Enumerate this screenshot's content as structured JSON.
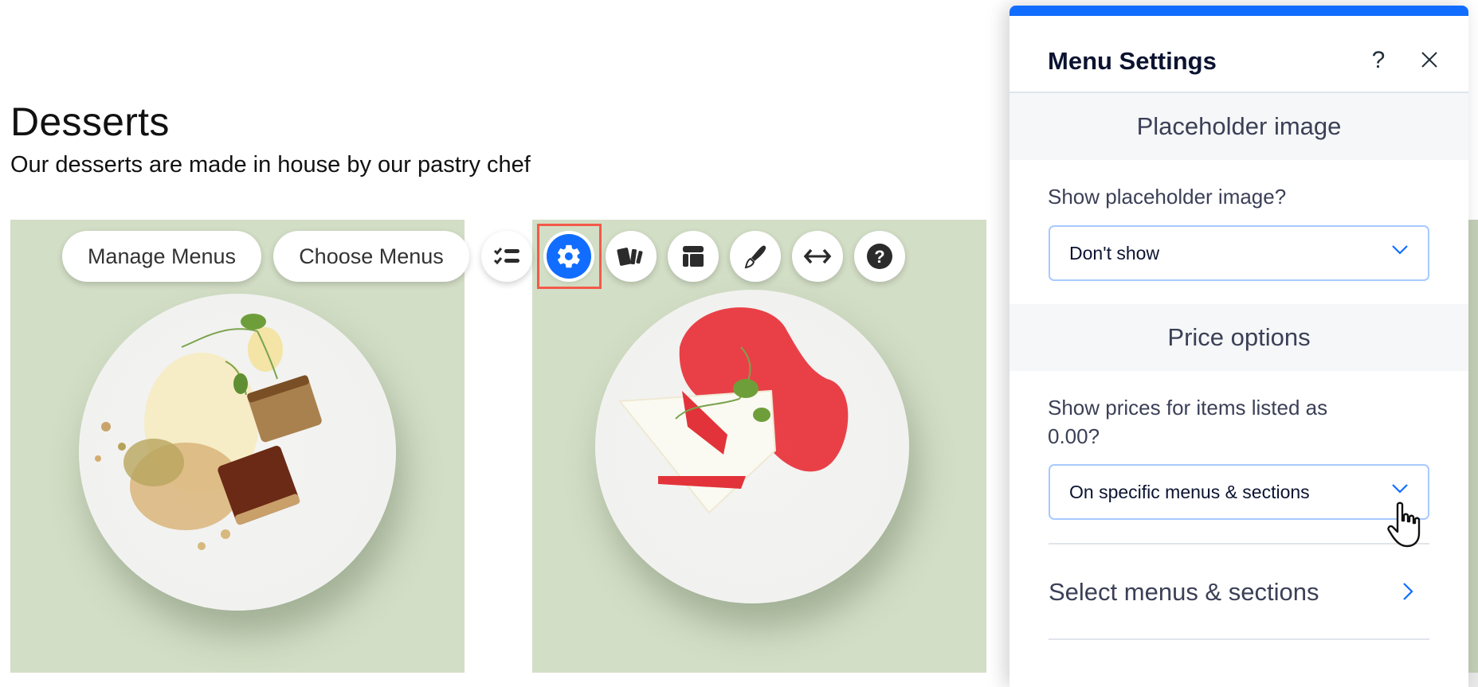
{
  "page": {
    "title": "Desserts",
    "subtitle": "Our desserts are made in house by our pastry chef"
  },
  "toolbar": {
    "manage_menus_label": "Manage Menus",
    "choose_menus_label": "Choose Menus",
    "icons": [
      {
        "name": "checklist-icon",
        "label": "Manage items"
      },
      {
        "name": "gear-icon",
        "label": "Settings",
        "active": true
      },
      {
        "name": "cards-icon",
        "label": "Layouts"
      },
      {
        "name": "layout-icon",
        "label": "Layout"
      },
      {
        "name": "paintbrush-icon",
        "label": "Design"
      },
      {
        "name": "stretch-arrows-icon",
        "label": "Stretch"
      },
      {
        "name": "help-icon",
        "label": "Help"
      }
    ]
  },
  "food_items": [
    {
      "name": "pistachio-dessert-plate",
      "description": "Cream dessert with pistachio crumble and caramelized cake squares"
    },
    {
      "name": "strawberry-cheesecake-plate",
      "description": "Cheesecake slice with strawberry sauce and sliced strawberries"
    }
  ],
  "panel": {
    "title": "Menu Settings",
    "help_label": "?",
    "sections": [
      {
        "heading": "Placeholder image",
        "field_label": "Show placeholder image?",
        "dropdown_value": "Don't show"
      },
      {
        "heading": "Price options",
        "field_label_line1": "Show prices for items listed as",
        "field_label_line2": "0.00?",
        "dropdown_value": "On specific menus & sections",
        "nav_row_label": "Select menus & sections"
      }
    ]
  },
  "colors": {
    "accent": "#116dff",
    "highlight": "#f25a4a",
    "tile_background": "#d3dec6"
  }
}
